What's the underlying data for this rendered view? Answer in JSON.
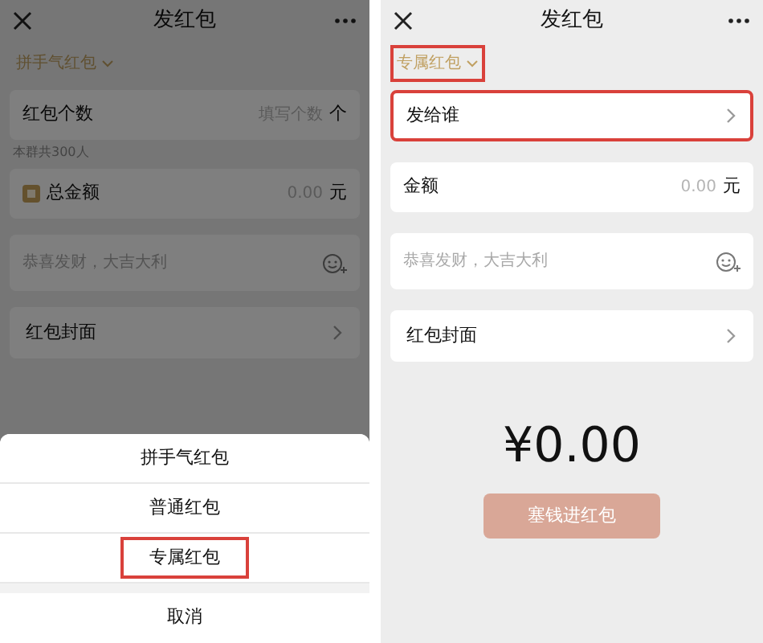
{
  "screens": [
    {
      "dimmed": true,
      "title": "发红包",
      "type_selector": {
        "label": "拼手气红包",
        "highlighted": false
      },
      "rows": [
        {
          "kind": "count",
          "label": "红包个数",
          "placeholder": "填写个数",
          "unit": "个",
          "hint": "本群共300人"
        },
        {
          "kind": "amount",
          "label": "总金额",
          "badge": true,
          "placeholder": "0.00",
          "unit": "元"
        },
        {
          "kind": "greeting",
          "placeholder": "恭喜发财，大吉大利"
        },
        {
          "kind": "link",
          "label": "红包封面",
          "highlighted": false
        }
      ],
      "sheet": {
        "options": [
          {
            "label": "拼手气红包",
            "highlighted": false
          },
          {
            "label": "普通红包",
            "highlighted": false
          },
          {
            "label": "专属红包",
            "highlighted": true
          }
        ],
        "cancel": "取消"
      }
    },
    {
      "dimmed": false,
      "title": "发红包",
      "type_selector": {
        "label": "专属红包",
        "highlighted": true
      },
      "rows": [
        {
          "kind": "link",
          "label": "发给谁",
          "highlighted": true
        },
        {
          "kind": "amount",
          "label": "金额",
          "badge": false,
          "placeholder": "0.00",
          "unit": "元"
        },
        {
          "kind": "greeting",
          "placeholder": "恭喜发财，大吉大利"
        },
        {
          "kind": "link",
          "label": "红包封面",
          "highlighted": false
        }
      ],
      "total": "¥0.00",
      "button": {
        "label": "塞钱进红包",
        "disabled": true
      }
    }
  ]
}
